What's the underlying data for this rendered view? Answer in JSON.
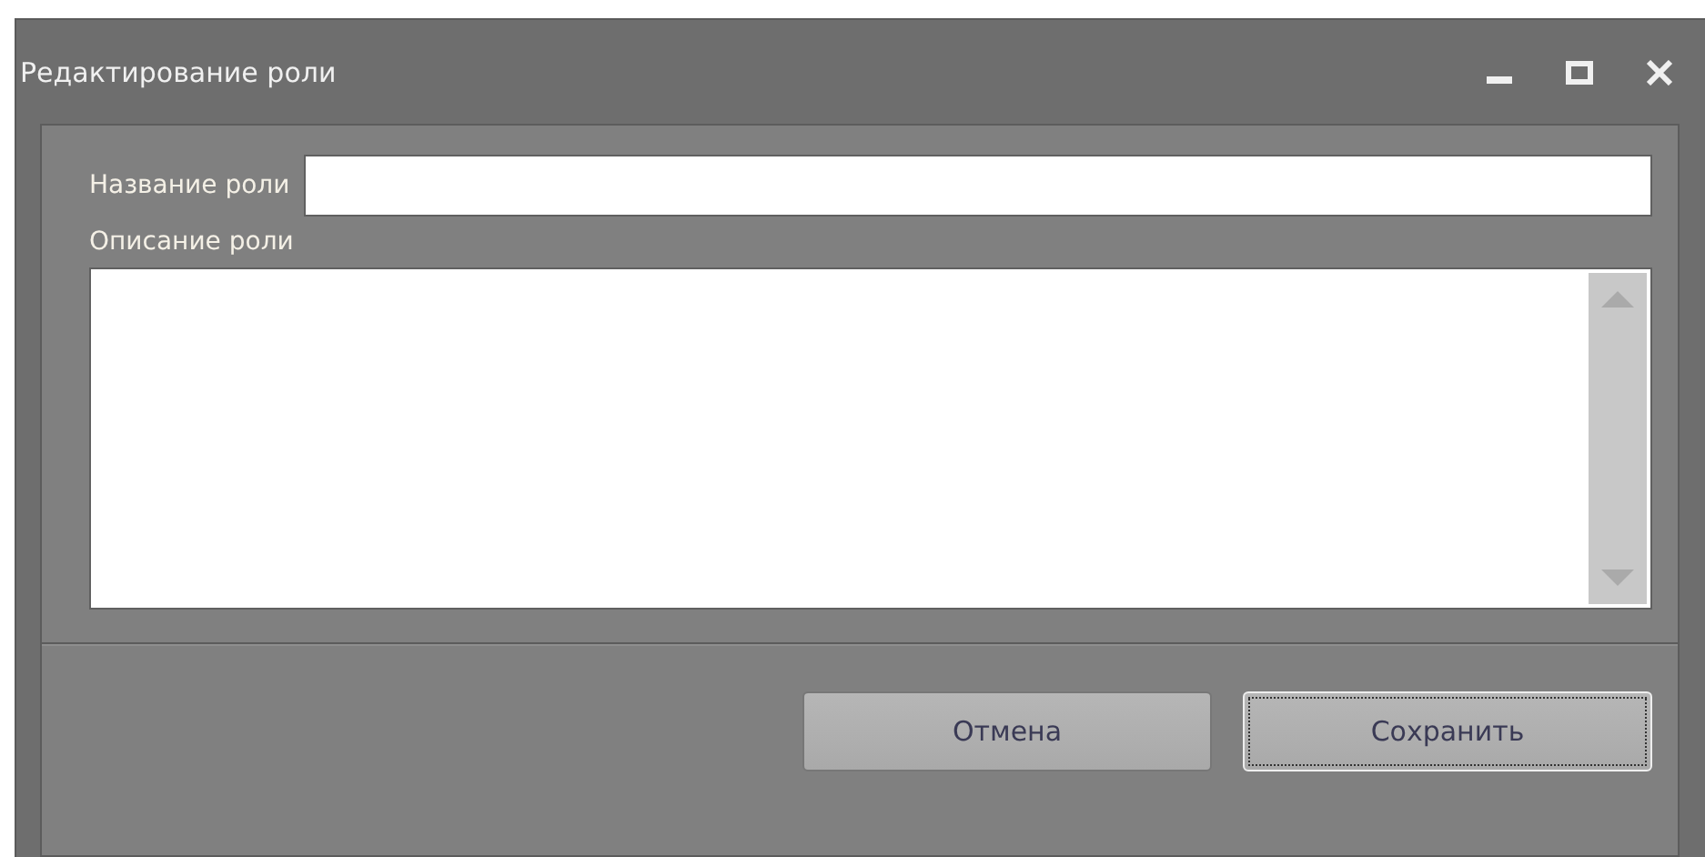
{
  "window": {
    "title": "Редактирование роли"
  },
  "fields": [
    {
      "kind": "line",
      "label": "Название роли"
    },
    {
      "kind": "area",
      "label": "Описание роли"
    }
  ],
  "buttons": [
    {
      "label": "Отмена",
      "focused": false
    },
    {
      "label": "Сохранить",
      "focused": true
    }
  ]
}
